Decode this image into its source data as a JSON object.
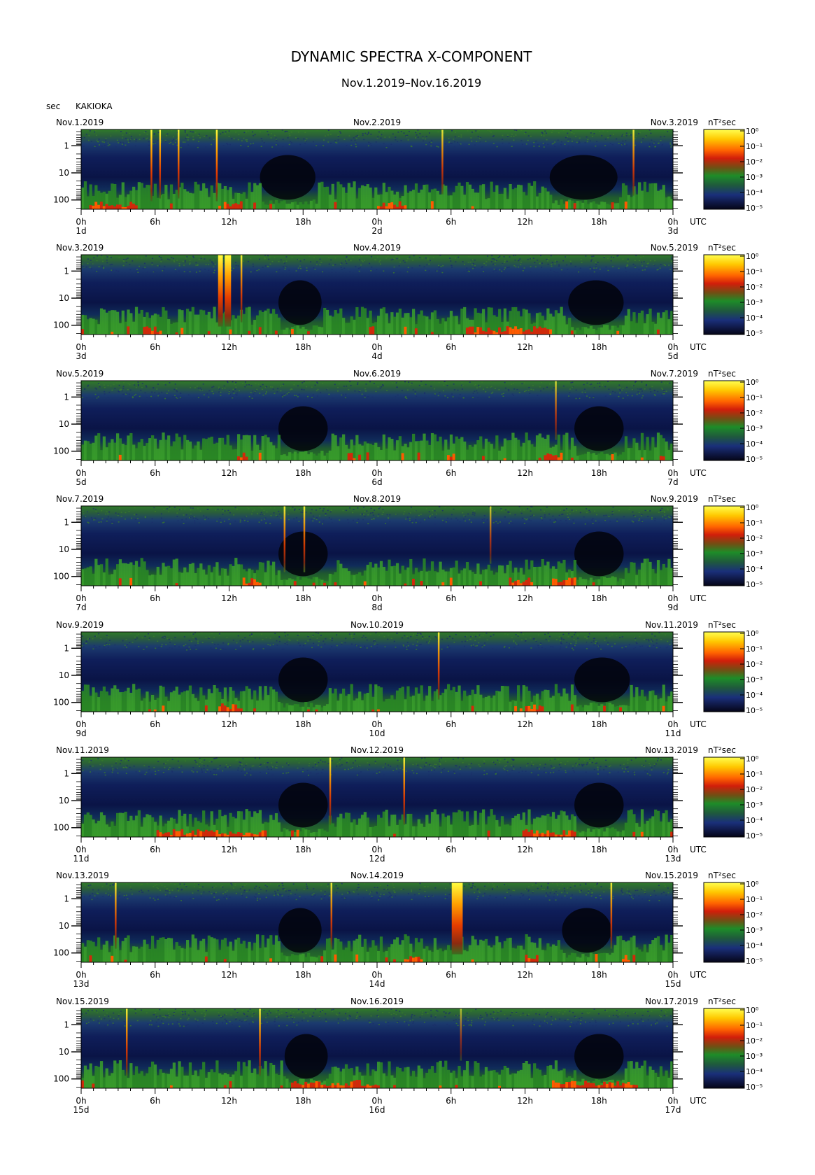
{
  "chart_data": {
    "type": "heatmap",
    "title": "DYNAMIC SPECTRA X-COMPONENT",
    "subtitle": "Nov.1.2019–Nov.16.2019",
    "station": "KAKIOKA",
    "ylabel": "sec",
    "colorbar_label": "nT²sec",
    "utc_label": "UTC",
    "x_ticks": [
      "0h",
      "6h",
      "12h",
      "18h",
      "0h",
      "6h",
      "12h",
      "18h",
      "0h"
    ],
    "y_ticks": [
      {
        "value": 1,
        "label": "1"
      },
      {
        "value": 10,
        "label": "10"
      },
      {
        "value": 100,
        "label": "100"
      }
    ],
    "ylim_sec": [
      0.25,
      220
    ],
    "colorbar_ticks": [
      "10⁰",
      "10⁻¹",
      "10⁻²",
      "10⁻³",
      "10⁻⁴",
      "10⁻⁵"
    ],
    "colormap": [
      "#05051a",
      "#0a1a55",
      "#1f3c8a",
      "#1f6e2a",
      "#2ea02a",
      "#c81e0a",
      "#ff3c00",
      "#ff8c00",
      "#ffd200",
      "#ffff50"
    ],
    "panels": [
      {
        "date_left": "Nov.1.2019",
        "date_mid": "Nov.2.2019",
        "date_right": "Nov.3.2019",
        "day_labels": [
          "1d",
          "2d",
          "3d"
        ],
        "events": [
          {
            "hour": 5.7,
            "strength": 1.0,
            "width": 1
          },
          {
            "hour": 6.4,
            "strength": 0.9,
            "width": 1
          },
          {
            "hour": 7.9,
            "strength": 0.9,
            "width": 1
          },
          {
            "hour": 11.0,
            "strength": 1.0,
            "width": 1
          },
          {
            "hour": 29.3,
            "strength": 0.75,
            "width": 1
          },
          {
            "hour": 44.8,
            "strength": 0.8,
            "width": 1
          }
        ],
        "quiet": [
          {
            "from": 14.5,
            "to": 19.0
          },
          {
            "from": 38.0,
            "to": 43.5
          }
        ],
        "red_patches": [
          {
            "from": 0.5,
            "to": 4.5
          },
          {
            "from": 11.5,
            "to": 13.0
          },
          {
            "from": 24.0,
            "to": 26.0
          }
        ]
      },
      {
        "date_left": "Nov.3.2019",
        "date_mid": "Nov.4.2019",
        "date_right": "Nov.5.2019",
        "day_labels": [
          "3d",
          "4d",
          "5d"
        ],
        "events": [
          {
            "hour": 11.3,
            "strength": 1.0,
            "width": 3
          },
          {
            "hour": 11.9,
            "strength": 1.0,
            "width": 4
          },
          {
            "hour": 13.0,
            "strength": 0.85,
            "width": 1
          }
        ],
        "quiet": [
          {
            "from": 16.0,
            "to": 19.5
          },
          {
            "from": 39.5,
            "to": 44.0
          }
        ],
        "red_patches": [
          {
            "from": 31.0,
            "to": 38.0
          },
          {
            "from": 5.0,
            "to": 6.5
          }
        ]
      },
      {
        "date_left": "Nov.5.2019",
        "date_mid": "Nov.6.2019",
        "date_right": "Nov.7.2019",
        "day_labels": [
          "5d",
          "6d",
          "7d"
        ],
        "events": [
          {
            "hour": 38.5,
            "strength": 0.55,
            "width": 1
          }
        ],
        "quiet": [
          {
            "from": 16.0,
            "to": 20.0
          },
          {
            "from": 40.0,
            "to": 44.0
          }
        ],
        "red_patches": [
          {
            "from": 12.5,
            "to": 13.5
          },
          {
            "from": 37.5,
            "to": 39.0
          }
        ]
      },
      {
        "date_left": "Nov.7.2019",
        "date_mid": "Nov.8.2019",
        "date_right": "Nov.9.2019",
        "day_labels": [
          "7d",
          "8d",
          "9d"
        ],
        "events": [
          {
            "hour": 16.5,
            "strength": 0.8,
            "width": 1
          },
          {
            "hour": 18.1,
            "strength": 0.8,
            "width": 1
          },
          {
            "hour": 33.2,
            "strength": 0.5,
            "width": 1
          }
        ],
        "quiet": [
          {
            "from": 16.0,
            "to": 20.0
          },
          {
            "from": 40.0,
            "to": 44.0
          }
        ],
        "red_patches": [
          {
            "from": 34.5,
            "to": 36.5
          },
          {
            "from": 38.0,
            "to": 40.0
          },
          {
            "from": 13.0,
            "to": 14.5
          }
        ]
      },
      {
        "date_left": "Nov.9.2019",
        "date_mid": "Nov.10.2019",
        "date_right": "Nov.11.2019",
        "day_labels": [
          "9d",
          "10d",
          "11d"
        ],
        "events": [
          {
            "hour": 29.0,
            "strength": 0.85,
            "width": 1
          }
        ],
        "quiet": [
          {
            "from": 16.0,
            "to": 20.0
          },
          {
            "from": 40.0,
            "to": 44.5
          }
        ],
        "red_patches": [
          {
            "from": 11.0,
            "to": 13.0
          },
          {
            "from": 36.0,
            "to": 37.5
          }
        ]
      },
      {
        "date_left": "Nov.11.2019",
        "date_mid": "Nov.12.2019",
        "date_right": "Nov.13.2019",
        "day_labels": [
          "11d",
          "12d",
          "13d"
        ],
        "events": [
          {
            "hour": 20.2,
            "strength": 0.85,
            "width": 1
          },
          {
            "hour": 26.2,
            "strength": 0.85,
            "width": 1
          }
        ],
        "quiet": [
          {
            "from": 16.0,
            "to": 20.0
          },
          {
            "from": 40.0,
            "to": 44.0
          }
        ],
        "red_patches": [
          {
            "from": 6.0,
            "to": 15.0
          },
          {
            "from": 36.0,
            "to": 40.0
          }
        ]
      },
      {
        "date_left": "Nov.13.2019",
        "date_mid": "Nov.14.2019",
        "date_right": "Nov.15.2019",
        "day_labels": [
          "13d",
          "14d",
          "15d"
        ],
        "events": [
          {
            "hour": 2.8,
            "strength": 0.8,
            "width": 1
          },
          {
            "hour": 20.3,
            "strength": 0.8,
            "width": 1
          },
          {
            "hour": 30.5,
            "strength": 1.0,
            "width": 7
          },
          {
            "hour": 43.0,
            "strength": 0.8,
            "width": 1
          }
        ],
        "quiet": [
          {
            "from": 16.0,
            "to": 19.5
          },
          {
            "from": 39.0,
            "to": 43.0
          }
        ],
        "red_patches": [
          {
            "from": 36.0,
            "to": 37.0
          },
          {
            "from": 26.0,
            "to": 27.5
          }
        ]
      },
      {
        "date_left": "Nov.15.2019",
        "date_mid": "Nov.16.2019",
        "date_right": "Nov.17.2019",
        "day_labels": [
          "15d",
          "16d",
          "17d"
        ],
        "events": [
          {
            "hour": 3.7,
            "strength": 0.85,
            "width": 1
          },
          {
            "hour": 14.5,
            "strength": 0.85,
            "width": 1
          },
          {
            "hour": 30.8,
            "strength": 0.3,
            "width": 1
          }
        ],
        "quiet": [
          {
            "from": 16.5,
            "to": 20.0
          },
          {
            "from": 40.0,
            "to": 44.0
          }
        ],
        "red_patches": [
          {
            "from": 17.0,
            "to": 24.0
          },
          {
            "from": 38.0,
            "to": 45.0
          }
        ]
      }
    ]
  }
}
